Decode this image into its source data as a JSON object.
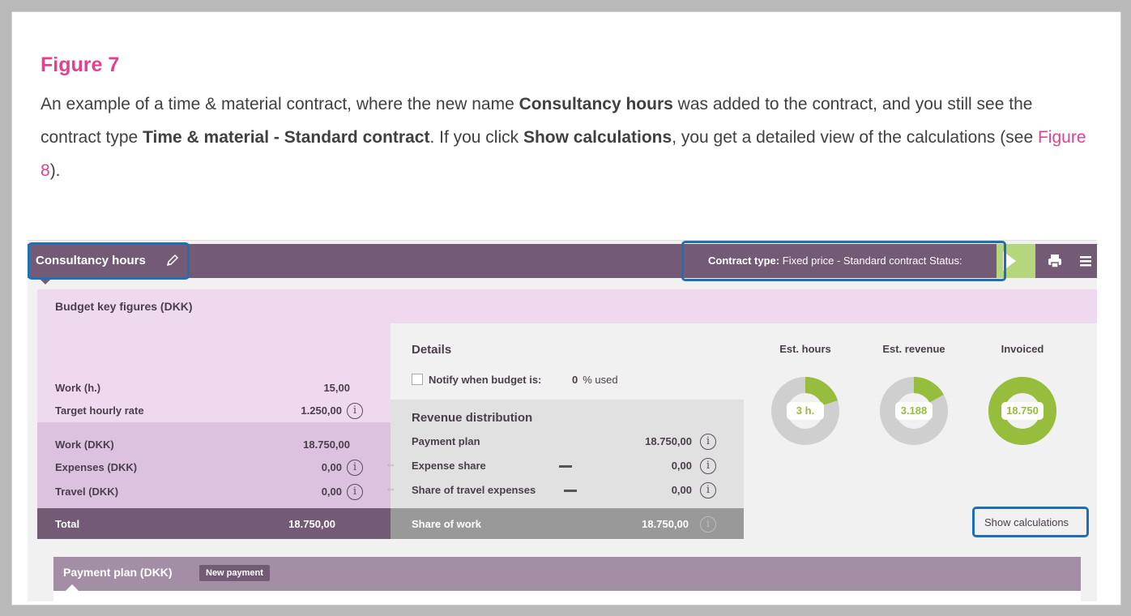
{
  "figure": {
    "title": "Figure 7",
    "text_1": "An example of a time & material contract, where the new name ",
    "bold_1": "Consultancy hours",
    "text_2": " was added to the contract, and you still see the contract type ",
    "bold_2": "Time & material - Standard contract",
    "text_3": ". If you click ",
    "bold_3": "Show calculations",
    "text_4": ", you get a detailed view of the calculations (see ",
    "link": "Figure 8",
    "text_5": ")."
  },
  "topbar": {
    "contract_name": "Consultancy hours",
    "contract_type_label": "Contract type:",
    "contract_type_value": "Fixed price - Standard contract",
    "status_label": "Status:",
    "icons": [
      "edit-icon",
      "play-icon",
      "print-icon",
      "menu-icon"
    ]
  },
  "budget": {
    "title": "Budget key figures (DKK)",
    "rows": [
      {
        "label": "Work (h.)",
        "value": "15,00"
      },
      {
        "label": "Target hourly rate",
        "value": "1.250,00"
      },
      {
        "label": "Work (DKK)",
        "value": "18.750,00"
      },
      {
        "label": "Expenses (DKK)",
        "value": "0,00"
      },
      {
        "label": "Travel (DKK)",
        "value": "0,00"
      }
    ],
    "total_label": "Total",
    "total_value": "18.750,00"
  },
  "details": {
    "title": "Details",
    "notify_label": "Notify when budget is:",
    "notify_value": "0",
    "notify_unit": "% used",
    "revenue_title": "Revenue distribution",
    "revenue_rows": [
      {
        "label": "Payment plan",
        "value": "18.750,00"
      },
      {
        "label": "Expense share",
        "value": "0,00"
      },
      {
        "label": "Share of travel expenses",
        "value": "0,00"
      }
    ],
    "share_label": "Share of work",
    "share_value": "18.750,00"
  },
  "donuts": [
    {
      "label": "Est. hours",
      "value": "3 h.",
      "fraction": 0.2
    },
    {
      "label": "Est. revenue",
      "value": "3.188",
      "fraction": 0.17
    },
    {
      "label": "Invoiced",
      "value": "18.750",
      "fraction": 1.0
    }
  ],
  "show_calculations": "Show calculations",
  "payment_plan": {
    "title": "Payment plan (DKK)",
    "new_button": "New payment"
  },
  "colors": {
    "accent": "#735a75",
    "lilac": "#efd9ef",
    "green": "#96bd3c",
    "highlight": "#1f6fb5",
    "figure_pink": "#e0428f"
  }
}
